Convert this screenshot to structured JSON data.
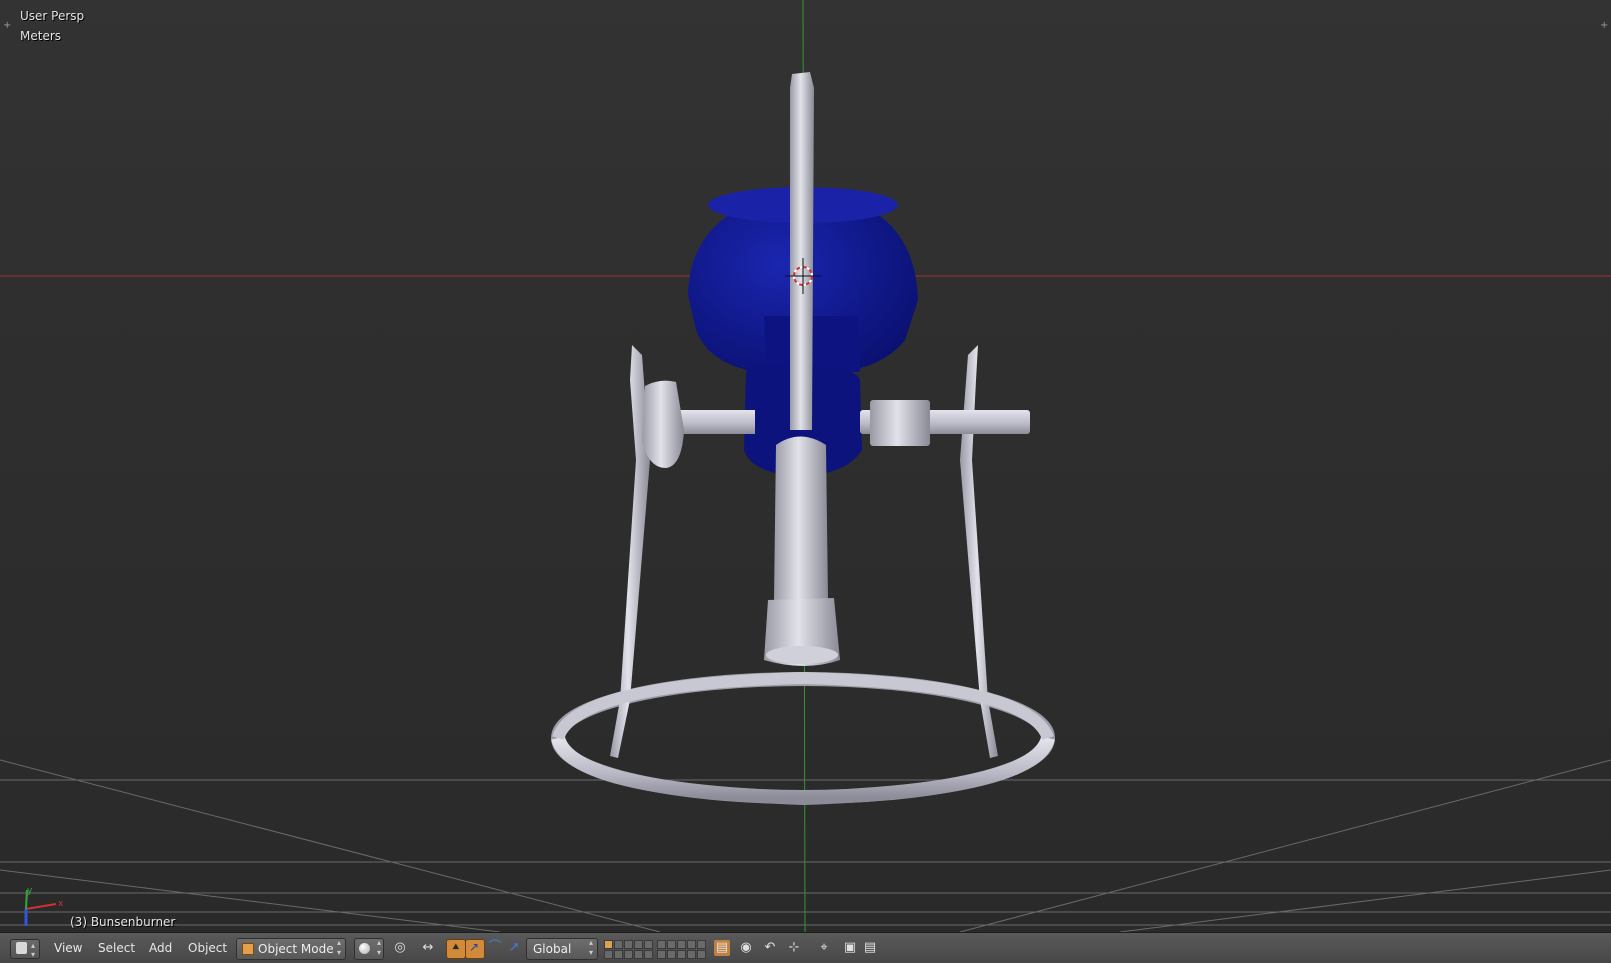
{
  "viewport": {
    "view_label": "User Persp",
    "units_label": "Meters",
    "object_info": "(3) Bunsenburner",
    "axis_labels": {
      "x": "x",
      "y": "y"
    }
  },
  "header": {
    "editor_type_icon": "3d-view-cube-icon",
    "menus": [
      "View",
      "Select",
      "Add",
      "Object"
    ],
    "mode": {
      "icon": "object-cube-icon",
      "label": "Object Mode"
    },
    "shading_icon": "solid-sphere-icon",
    "pivot_icon": "pivot-point-icon",
    "manipulator_icons": [
      "manipulator-toggle-icon",
      "translate-icon",
      "rotate-icon",
      "scale-icon"
    ],
    "orientation": "Global",
    "snap_icons": [
      "magnet-icon",
      "snap-target-icon"
    ],
    "render_icons": [
      "opengl-render-icon",
      "opengl-animation-icon"
    ]
  },
  "colors": {
    "background": "#2a2a2a",
    "x_axis": "#a03030",
    "y_axis": "#2f9a2f",
    "model_metal": "#c4c4cc",
    "model_blue": "#101a8a",
    "header": "#4f4f4f"
  }
}
